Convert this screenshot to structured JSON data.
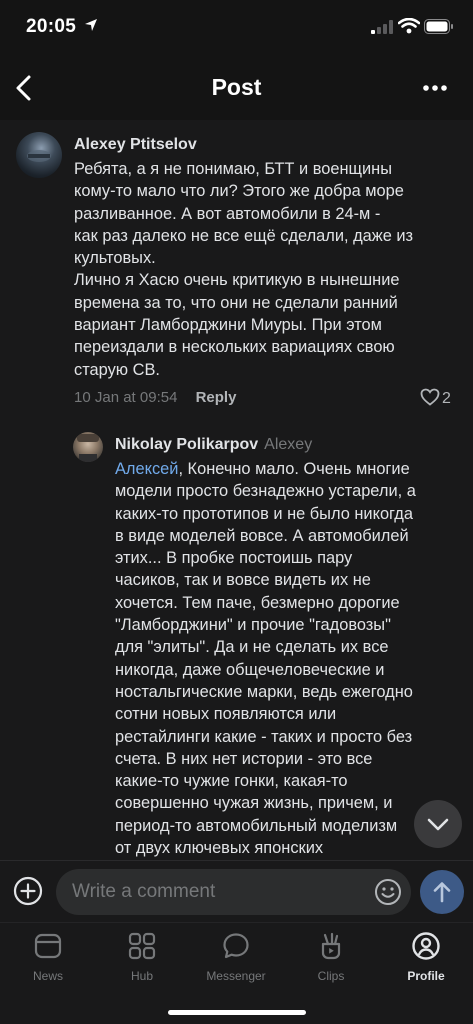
{
  "status_bar": {
    "time": "20:05"
  },
  "header": {
    "title": "Post"
  },
  "comments": [
    {
      "author": "Alexey Ptitselov",
      "lines": [
        "Ребята, а я не понимаю, БТТ и военщины",
        "кому-то мало что ли? Этого же добра море",
        "разливанное. А вот автомобили в 24-м -",
        "как раз далеко не все ещё сделали, даже из",
        "культовых.",
        "Лично я Хасю очень критикую в нынешние",
        "времена за то, что они не сделали ранний",
        "вариант Ламборджини Миуры. При этом",
        "переиздали в нескольких вариациях свою",
        "старую СВ."
      ],
      "date": "10 Jan at 09:54",
      "reply_label": "Reply",
      "likes": "2"
    },
    {
      "author": "Nikolay Polikarpov",
      "reply_to": "Alexey",
      "mention": "Алексей",
      "first_line_rest": ", Конечно мало. Очень многие",
      "lines": [
        "модели просто безнадежно устарели, а",
        "каких-то прототипов и не было никогда",
        "в виде моделей вовсе. А автомобилей",
        "этих... В пробке постоишь пару",
        "часиков, так и вовсе видеть их не",
        "хочется. Тем паче, безмерно дорогие",
        "\"Ламборджини\" и прочие \"гадовозы\"",
        "для \"элиты\". Да и не сделать их все",
        "никогда, даже общечеловеческие и",
        "ностальгические марки, ведь ежегодно",
        "сотни новых появляются или",
        "рестайлинги какие - таких и просто без",
        "счета. В них нет истории - это все",
        "какие-то чужие гонки, какая-то",
        "совершенно чужая жизнь, причем, и",
        "период-то автомобильный моделизм",
        "от двух ключевых японских"
      ]
    }
  ],
  "composer": {
    "placeholder": "Write a comment"
  },
  "tabbar": {
    "items": [
      {
        "label": "News",
        "icon": "news-icon"
      },
      {
        "label": "Hub",
        "icon": "hub-icon"
      },
      {
        "label": "Messenger",
        "icon": "messenger-icon"
      },
      {
        "label": "Clips",
        "icon": "clips-icon"
      },
      {
        "label": "Profile",
        "icon": "profile-icon",
        "active": true
      }
    ]
  },
  "colors": {
    "background": "#19191a",
    "text": "#e1e3e6",
    "secondary": "#76787a",
    "mention": "#71aaeb",
    "send_button": "#3d5a87"
  }
}
